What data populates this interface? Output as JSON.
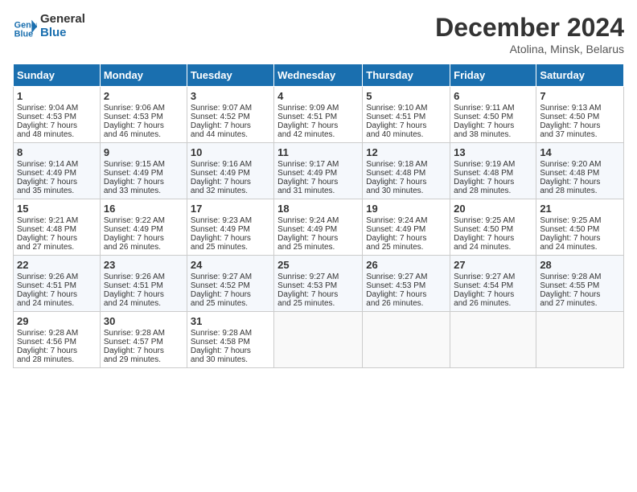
{
  "header": {
    "logo_line1": "General",
    "logo_line2": "Blue",
    "month_title": "December 2024",
    "location": "Atolina, Minsk, Belarus"
  },
  "days_of_week": [
    "Sunday",
    "Monday",
    "Tuesday",
    "Wednesday",
    "Thursday",
    "Friday",
    "Saturday"
  ],
  "weeks": [
    [
      {
        "day": "1",
        "lines": [
          "Sunrise: 9:04 AM",
          "Sunset: 4:53 PM",
          "Daylight: 7 hours",
          "and 48 minutes."
        ]
      },
      {
        "day": "2",
        "lines": [
          "Sunrise: 9:06 AM",
          "Sunset: 4:53 PM",
          "Daylight: 7 hours",
          "and 46 minutes."
        ]
      },
      {
        "day": "3",
        "lines": [
          "Sunrise: 9:07 AM",
          "Sunset: 4:52 PM",
          "Daylight: 7 hours",
          "and 44 minutes."
        ]
      },
      {
        "day": "4",
        "lines": [
          "Sunrise: 9:09 AM",
          "Sunset: 4:51 PM",
          "Daylight: 7 hours",
          "and 42 minutes."
        ]
      },
      {
        "day": "5",
        "lines": [
          "Sunrise: 9:10 AM",
          "Sunset: 4:51 PM",
          "Daylight: 7 hours",
          "and 40 minutes."
        ]
      },
      {
        "day": "6",
        "lines": [
          "Sunrise: 9:11 AM",
          "Sunset: 4:50 PM",
          "Daylight: 7 hours",
          "and 38 minutes."
        ]
      },
      {
        "day": "7",
        "lines": [
          "Sunrise: 9:13 AM",
          "Sunset: 4:50 PM",
          "Daylight: 7 hours",
          "and 37 minutes."
        ]
      }
    ],
    [
      {
        "day": "8",
        "lines": [
          "Sunrise: 9:14 AM",
          "Sunset: 4:49 PM",
          "Daylight: 7 hours",
          "and 35 minutes."
        ]
      },
      {
        "day": "9",
        "lines": [
          "Sunrise: 9:15 AM",
          "Sunset: 4:49 PM",
          "Daylight: 7 hours",
          "and 33 minutes."
        ]
      },
      {
        "day": "10",
        "lines": [
          "Sunrise: 9:16 AM",
          "Sunset: 4:49 PM",
          "Daylight: 7 hours",
          "and 32 minutes."
        ]
      },
      {
        "day": "11",
        "lines": [
          "Sunrise: 9:17 AM",
          "Sunset: 4:49 PM",
          "Daylight: 7 hours",
          "and 31 minutes."
        ]
      },
      {
        "day": "12",
        "lines": [
          "Sunrise: 9:18 AM",
          "Sunset: 4:48 PM",
          "Daylight: 7 hours",
          "and 30 minutes."
        ]
      },
      {
        "day": "13",
        "lines": [
          "Sunrise: 9:19 AM",
          "Sunset: 4:48 PM",
          "Daylight: 7 hours",
          "and 28 minutes."
        ]
      },
      {
        "day": "14",
        "lines": [
          "Sunrise: 9:20 AM",
          "Sunset: 4:48 PM",
          "Daylight: 7 hours",
          "and 28 minutes."
        ]
      }
    ],
    [
      {
        "day": "15",
        "lines": [
          "Sunrise: 9:21 AM",
          "Sunset: 4:48 PM",
          "Daylight: 7 hours",
          "and 27 minutes."
        ]
      },
      {
        "day": "16",
        "lines": [
          "Sunrise: 9:22 AM",
          "Sunset: 4:49 PM",
          "Daylight: 7 hours",
          "and 26 minutes."
        ]
      },
      {
        "day": "17",
        "lines": [
          "Sunrise: 9:23 AM",
          "Sunset: 4:49 PM",
          "Daylight: 7 hours",
          "and 25 minutes."
        ]
      },
      {
        "day": "18",
        "lines": [
          "Sunrise: 9:24 AM",
          "Sunset: 4:49 PM",
          "Daylight: 7 hours",
          "and 25 minutes."
        ]
      },
      {
        "day": "19",
        "lines": [
          "Sunrise: 9:24 AM",
          "Sunset: 4:49 PM",
          "Daylight: 7 hours",
          "and 25 minutes."
        ]
      },
      {
        "day": "20",
        "lines": [
          "Sunrise: 9:25 AM",
          "Sunset: 4:50 PM",
          "Daylight: 7 hours",
          "and 24 minutes."
        ]
      },
      {
        "day": "21",
        "lines": [
          "Sunrise: 9:25 AM",
          "Sunset: 4:50 PM",
          "Daylight: 7 hours",
          "and 24 minutes."
        ]
      }
    ],
    [
      {
        "day": "22",
        "lines": [
          "Sunrise: 9:26 AM",
          "Sunset: 4:51 PM",
          "Daylight: 7 hours",
          "and 24 minutes."
        ]
      },
      {
        "day": "23",
        "lines": [
          "Sunrise: 9:26 AM",
          "Sunset: 4:51 PM",
          "Daylight: 7 hours",
          "and 24 minutes."
        ]
      },
      {
        "day": "24",
        "lines": [
          "Sunrise: 9:27 AM",
          "Sunset: 4:52 PM",
          "Daylight: 7 hours",
          "and 25 minutes."
        ]
      },
      {
        "day": "25",
        "lines": [
          "Sunrise: 9:27 AM",
          "Sunset: 4:53 PM",
          "Daylight: 7 hours",
          "and 25 minutes."
        ]
      },
      {
        "day": "26",
        "lines": [
          "Sunrise: 9:27 AM",
          "Sunset: 4:53 PM",
          "Daylight: 7 hours",
          "and 26 minutes."
        ]
      },
      {
        "day": "27",
        "lines": [
          "Sunrise: 9:27 AM",
          "Sunset: 4:54 PM",
          "Daylight: 7 hours",
          "and 26 minutes."
        ]
      },
      {
        "day": "28",
        "lines": [
          "Sunrise: 9:28 AM",
          "Sunset: 4:55 PM",
          "Daylight: 7 hours",
          "and 27 minutes."
        ]
      }
    ],
    [
      {
        "day": "29",
        "lines": [
          "Sunrise: 9:28 AM",
          "Sunset: 4:56 PM",
          "Daylight: 7 hours",
          "and 28 minutes."
        ]
      },
      {
        "day": "30",
        "lines": [
          "Sunrise: 9:28 AM",
          "Sunset: 4:57 PM",
          "Daylight: 7 hours",
          "and 29 minutes."
        ]
      },
      {
        "day": "31",
        "lines": [
          "Sunrise: 9:28 AM",
          "Sunset: 4:58 PM",
          "Daylight: 7 hours",
          "and 30 minutes."
        ]
      },
      null,
      null,
      null,
      null
    ]
  ]
}
